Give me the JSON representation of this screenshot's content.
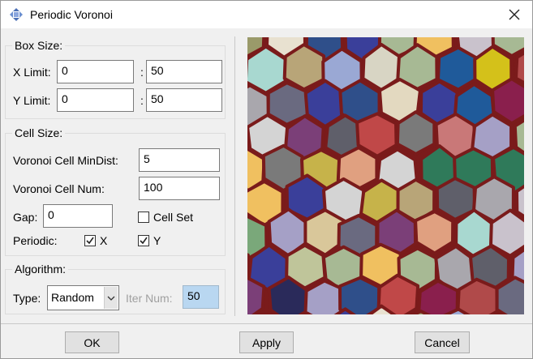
{
  "window": {
    "title": "Periodic Voronoi"
  },
  "box_size": {
    "title": "Box Size:",
    "x_limit_label": "X Limit:",
    "x_min": "0",
    "x_max": "50",
    "y_limit_label": "Y Limit:",
    "y_min": "0",
    "y_max": "50",
    "separator": ":"
  },
  "cell_size": {
    "title": "Cell Size:",
    "mindist_label": "Voronoi Cell MinDist:",
    "mindist_value": "5",
    "num_label": "Voronoi Cell Num:",
    "num_value": "100",
    "gap_label": "Gap:",
    "gap_value": "0",
    "cell_set_label": "Cell Set",
    "cell_set_checked": false,
    "periodic_label": "Periodic:",
    "periodic_x_label": "X",
    "periodic_x_checked": true,
    "periodic_y_label": "Y",
    "periodic_y_checked": true
  },
  "algorithm": {
    "title": "Algorithm:",
    "type_label": "Type:",
    "type_value": "Random",
    "iter_label": "Iter Num:",
    "iter_value": "50"
  },
  "buttons": {
    "ok": "OK",
    "apply": "Apply",
    "cancel": "Cancel"
  },
  "preview": {
    "edge_color": "#7a1b1b",
    "palette": [
      "#2f7a5a",
      "#d8d5c4",
      "#c04848",
      "#8a1f4d",
      "#a9a7ad",
      "#9aa8d4",
      "#c9c2cc",
      "#a5a0c6",
      "#9fbcd0",
      "#7b3f78",
      "#5f5f6a",
      "#3a3f9a",
      "#c6b34a",
      "#a7b994",
      "#e3d9c0",
      "#1f5a9a",
      "#b8a578",
      "#2f4f8a",
      "#d4c11a",
      "#9a9a6a",
      "#6a6a80",
      "#bfc59a",
      "#d9c79a",
      "#e8e1d0",
      "#d4d4d4",
      "#c97878",
      "#7a7a7a",
      "#a8d8d0",
      "#b04a4a",
      "#2a2a5a",
      "#f0c060",
      "#e0a080",
      "#7aa87a"
    ]
  }
}
